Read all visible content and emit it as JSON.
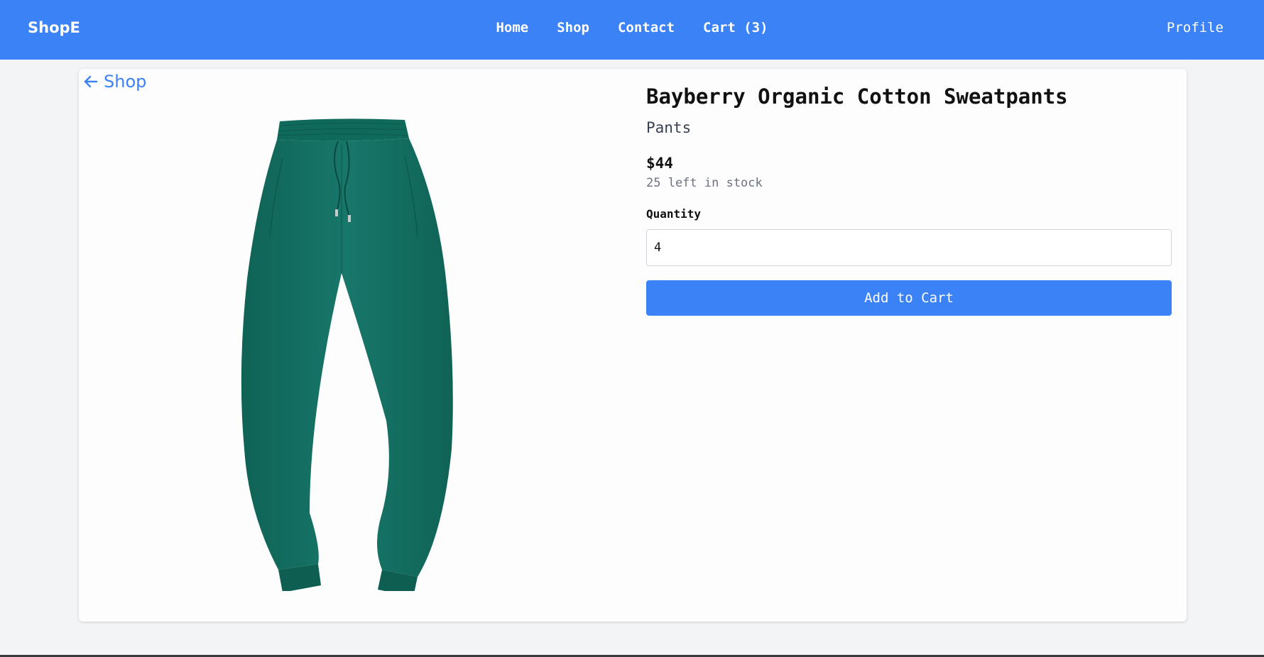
{
  "navbar": {
    "brand": "ShopE",
    "links": [
      {
        "label": "Home"
      },
      {
        "label": "Shop"
      },
      {
        "label": "Contact"
      },
      {
        "label": "Cart (3)"
      }
    ],
    "profile_label": "Profile",
    "background_color": "#3b82f6"
  },
  "back_link": {
    "icon": "arrow-left-icon",
    "label": "Shop"
  },
  "product": {
    "image": "green-sweatpants",
    "image_color": "#136e5e",
    "title": "Bayberry Organic Cotton Sweatpants",
    "category": "Pants",
    "price": "$44",
    "stock_text": "25 left in stock",
    "quantity_label": "Quantity",
    "quantity_value": "4",
    "add_to_cart_label": "Add to Cart"
  },
  "colors": {
    "accent": "#3b82f6",
    "page_background": "#f3f4f6",
    "card_background": "#fdfdfd"
  }
}
